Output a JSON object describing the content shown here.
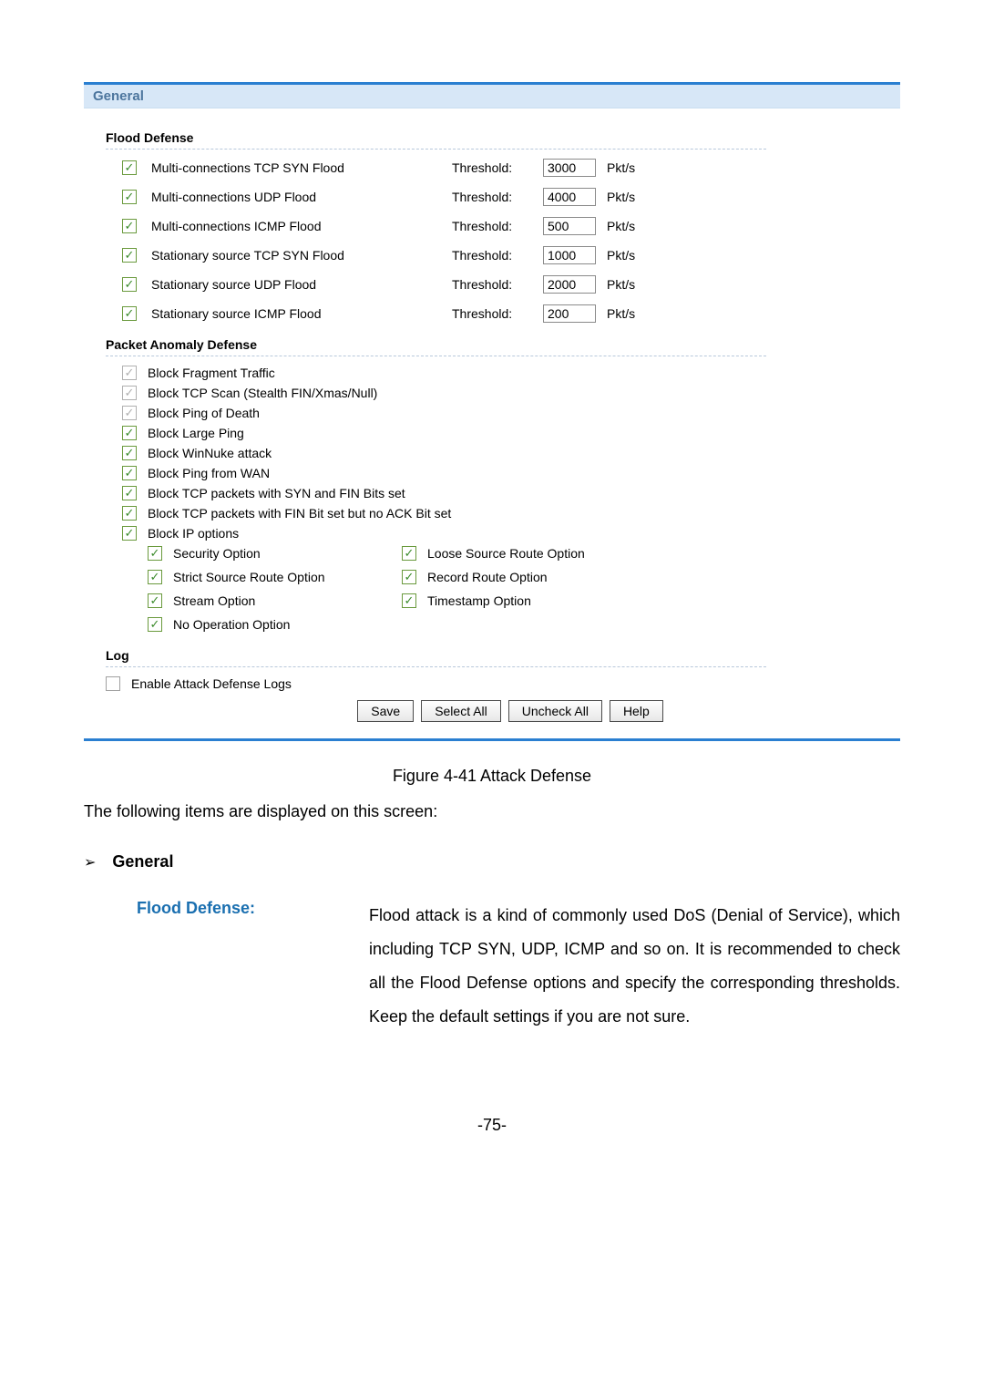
{
  "panel": {
    "header": "General",
    "flood": {
      "title": "Flood Defense",
      "thr_label": "Threshold:",
      "unit": "Pkt/s",
      "items": [
        {
          "label": "Multi-connections TCP SYN Flood",
          "value": "3000",
          "checked": true,
          "disabled": false
        },
        {
          "label": "Multi-connections UDP Flood",
          "value": "4000",
          "checked": true,
          "disabled": false
        },
        {
          "label": "Multi-connections ICMP Flood",
          "value": "500",
          "checked": true,
          "disabled": false
        },
        {
          "label": "Stationary source TCP SYN Flood",
          "value": "1000",
          "checked": true,
          "disabled": false
        },
        {
          "label": "Stationary source UDP Flood",
          "value": "2000",
          "checked": true,
          "disabled": false
        },
        {
          "label": "Stationary source ICMP Flood",
          "value": "200",
          "checked": true,
          "disabled": false
        }
      ]
    },
    "anomaly": {
      "title": "Packet Anomaly Defense",
      "items": [
        {
          "label": "Block Fragment Traffic",
          "checked": true,
          "disabled": true
        },
        {
          "label": "Block TCP Scan (Stealth FIN/Xmas/Null)",
          "checked": true,
          "disabled": true
        },
        {
          "label": "Block Ping of Death",
          "checked": true,
          "disabled": true
        },
        {
          "label": "Block Large Ping",
          "checked": true,
          "disabled": false
        },
        {
          "label": "Block WinNuke attack",
          "checked": true,
          "disabled": false
        },
        {
          "label": "Block Ping from WAN",
          "checked": true,
          "disabled": false
        },
        {
          "label": "Block TCP packets with SYN and FIN Bits set",
          "checked": true,
          "disabled": false
        },
        {
          "label": "Block TCP packets with FIN Bit set but no ACK Bit set",
          "checked": true,
          "disabled": false
        },
        {
          "label": "Block IP options",
          "checked": true,
          "disabled": false
        }
      ],
      "ip_options": [
        {
          "a_label": "Security Option",
          "a_checked": true,
          "b_label": "Loose Source Route Option",
          "b_checked": true
        },
        {
          "a_label": "Strict Source Route Option",
          "a_checked": true,
          "b_label": "Record Route Option",
          "b_checked": true
        },
        {
          "a_label": "Stream Option",
          "a_checked": true,
          "b_label": "Timestamp Option",
          "b_checked": true
        },
        {
          "a_label": "No Operation Option",
          "a_checked": true,
          "b_label": "",
          "b_checked": false
        }
      ]
    },
    "log": {
      "title": "Log",
      "label": "Enable Attack Defense Logs",
      "checked": false
    },
    "buttons": {
      "save": "Save",
      "select_all": "Select All",
      "uncheck_all": "Uncheck All",
      "help": "Help"
    }
  },
  "figure": "Figure 4-41 Attack Defense",
  "intro": "The following items are displayed on this screen:",
  "bullet": "General",
  "defs": {
    "flood_label": "Flood Defense:",
    "flood_text": "Flood attack is a kind of commonly used DoS (Denial of Service), which including TCP SYN, UDP, ICMP and so on. It is recommended to check all the Flood Defense options and specify the corresponding thresholds. Keep the default settings if you are not sure."
  },
  "page_number": "-75-"
}
